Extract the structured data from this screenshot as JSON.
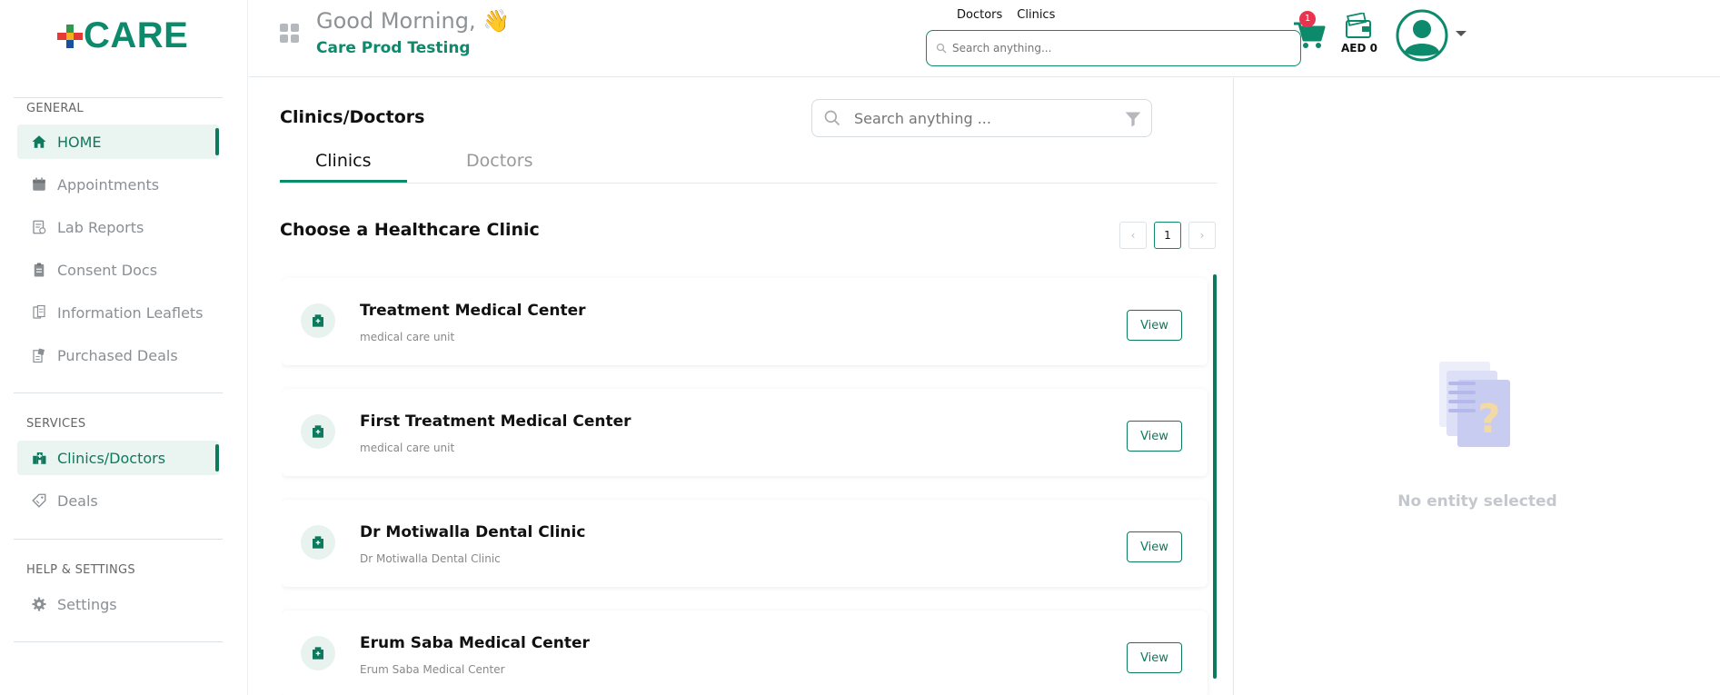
{
  "brand": {
    "name": "CARE"
  },
  "sidebar": {
    "sections": [
      {
        "title": "GENERAL"
      },
      {
        "title": "SERVICES"
      },
      {
        "title": "HELP & SETTINGS"
      }
    ],
    "items": [
      {
        "label": "HOME",
        "icon": "home-icon"
      },
      {
        "label": "Appointments",
        "icon": "calendar-icon"
      },
      {
        "label": "Lab Reports",
        "icon": "lab-report-icon"
      },
      {
        "label": "Consent Docs",
        "icon": "clipboard-icon"
      },
      {
        "label": "Information Leaflets",
        "icon": "leaflet-icon"
      },
      {
        "label": "Purchased Deals",
        "icon": "purchased-deals-icon"
      },
      {
        "label": "Clinics/Doctors",
        "icon": "hospital-icon"
      },
      {
        "label": "Deals",
        "icon": "tag-icon"
      },
      {
        "label": "Settings",
        "icon": "gear-icon"
      }
    ]
  },
  "header": {
    "greeting": "Good Morning, 👋",
    "org": "Care Prod Testing",
    "tabs": [
      "Doctors",
      "Clinics"
    ],
    "search_placeholder": "Search anything...",
    "cart_count": "1",
    "wallet": "AED 0"
  },
  "main": {
    "title": "Clinics/Doctors",
    "search_placeholder": "Search anything ...",
    "tabs": [
      {
        "label": "Clinics"
      },
      {
        "label": "Doctors"
      }
    ],
    "section_title": "Choose a Healthcare Clinic",
    "pagination": {
      "prev": "‹",
      "current": "1",
      "next": "›"
    },
    "view_label": "View",
    "clinics": [
      {
        "name": "Treatment Medical Center",
        "subtitle": "medical care unit"
      },
      {
        "name": "First Treatment Medical Center",
        "subtitle": "medical care unit"
      },
      {
        "name": "Dr Motiwalla Dental Clinic",
        "subtitle": "Dr Motiwalla Dental Clinic"
      },
      {
        "name": "Erum Saba Medical Center",
        "subtitle": "Erum Saba Medical Center"
      }
    ]
  },
  "right_panel": {
    "empty_text": "No entity selected"
  },
  "colors": {
    "accent": "#0d8a6c",
    "badge": "#e8344e"
  }
}
